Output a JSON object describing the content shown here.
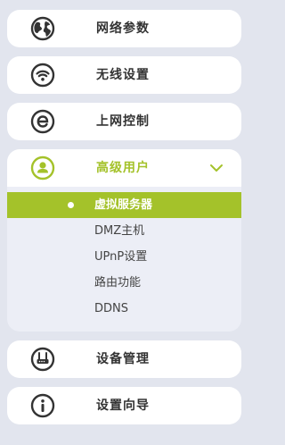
{
  "menu": {
    "network_params": "网络参数",
    "wireless_settings": "无线设置",
    "internet_control": "上网控制",
    "advanced_user": "高级用户",
    "device_management": "设备管理",
    "setup_wizard": "设置向导"
  },
  "submenu": {
    "items": [
      {
        "label": "虚拟服务器"
      },
      {
        "label": "DMZ主机"
      },
      {
        "label": "UPnP设置"
      },
      {
        "label": "路由功能"
      },
      {
        "label": "DDNS"
      }
    ],
    "selected_index": 0
  },
  "colors": {
    "accent": "#a4c22a",
    "background": "#e2e5ee",
    "item_bg": "#ffffff",
    "submenu_bg": "#eceef6",
    "icon": "#333333"
  },
  "icons": {
    "network_params": "globe-icon",
    "wireless_settings": "wifi-icon",
    "internet_control": "e-icon",
    "advanced_user": "user-icon",
    "device_management": "router-icon",
    "setup_wizard": "info-icon",
    "expand": "chevron-down-icon"
  }
}
